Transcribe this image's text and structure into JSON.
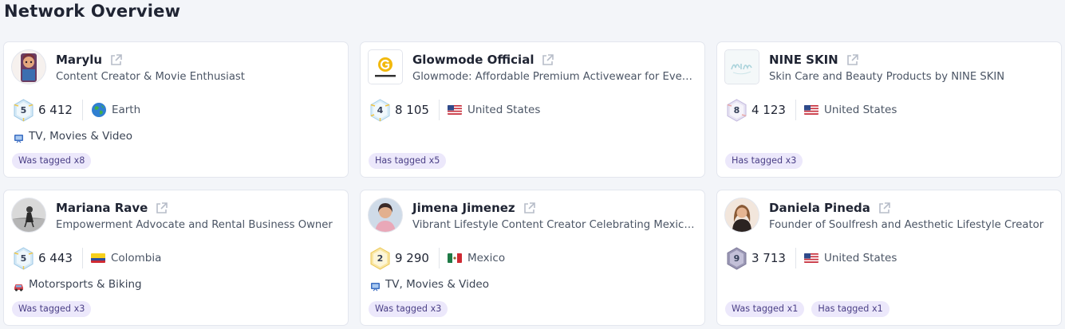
{
  "page": {
    "title": "Network Overview"
  },
  "cards": [
    {
      "name": "Marylu",
      "description": "Content Creator & Movie Enthusiast",
      "level": "5",
      "followers": "6 412",
      "location": "Earth",
      "location_icon": "globe-icon",
      "category": "TV, Movies & Video",
      "category_icon": "tv-icon",
      "tags": [
        "Was tagged x8"
      ]
    },
    {
      "name": "Glowmode Official",
      "description": "Glowmode: Affordable Premium Activewear for Everyone",
      "level": "4",
      "followers": "8 105",
      "location": "United States",
      "location_icon": "us-flag-icon",
      "category": "",
      "tags": [
        "Has tagged x5"
      ]
    },
    {
      "name": "NINE SKIN",
      "description": "Skin Care and Beauty Products by NINE SKIN",
      "level": "8",
      "followers": "4 123",
      "location": "United States",
      "location_icon": "us-flag-icon",
      "category": "",
      "tags": [
        "Has tagged x3"
      ]
    },
    {
      "name": "Mariana Rave",
      "description": "Empowerment Advocate and Rental Business Owner",
      "level": "5",
      "followers": "6 443",
      "location": "Colombia",
      "location_icon": "colombia-flag-icon",
      "category": "Motorsports & Biking",
      "category_icon": "car-icon",
      "tags": [
        "Was tagged x3"
      ]
    },
    {
      "name": "Jimena Jimenez",
      "description": "Vibrant Lifestyle Content Creator Celebrating Mexican Culture",
      "level": "2",
      "followers": "9 290",
      "location": "Mexico",
      "location_icon": "mexico-flag-icon",
      "category": "TV, Movies & Video",
      "category_icon": "tv-icon",
      "tags": [
        "Was tagged x3"
      ]
    },
    {
      "name": "Daniela Pineda",
      "description": "Founder of Soulfresh and Aesthetic Lifestyle Creator",
      "level": "9",
      "followers": "3 713",
      "location": "United States",
      "location_icon": "us-flag-icon",
      "category": "",
      "tags": [
        "Was tagged x1",
        "Has tagged x1"
      ]
    }
  ],
  "colors": {
    "background": "#f3f5f9",
    "card": "#ffffff",
    "tag_bg": "#ece8fb",
    "tag_text": "#4a3f86",
    "glowmode_brand": "#f2b90c"
  }
}
